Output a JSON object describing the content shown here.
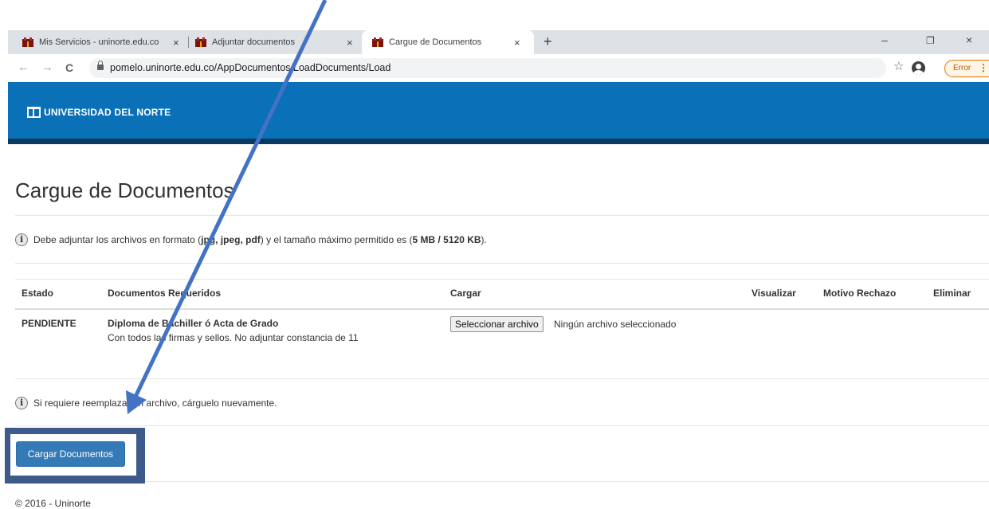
{
  "browser": {
    "tabs": [
      {
        "title": "Mis Servicios - uninorte.edu.co",
        "close": "×"
      },
      {
        "title": "Adjuntar documentos",
        "close": "×"
      },
      {
        "title": "Cargue de Documentos",
        "close": "×"
      }
    ],
    "new_tab": "+",
    "window_controls": {
      "minimize": "–",
      "restore": "❐",
      "close": "×"
    },
    "nav": {
      "back": "←",
      "forward": "→",
      "reload": "C"
    },
    "url": "pomelo.uninorte.edu.co/AppDocumentos/LoadDocuments/Load",
    "bookmark": "☆",
    "error_label": "Error",
    "menu": "⋮"
  },
  "site": {
    "logo_text": "UNIVERSIDAD DEL NORTE",
    "header_color": "#0a70b8"
  },
  "page": {
    "title": "Cargue de Documentos",
    "info_format": {
      "pre": "Debe adjuntar los archivos en formato (",
      "formats": "jpg, jpeg, pdf",
      "mid": ") y el tamaño máximo permitido es (",
      "size": "5 MB / 5120 KB",
      "post": ")."
    },
    "table": {
      "headers": {
        "estado": "Estado",
        "documentos": "Documentos Requeridos",
        "cargar": "Cargar",
        "visualizar": "Visualizar",
        "motivo": "Motivo Rechazo",
        "eliminar": "Eliminar"
      },
      "rows": [
        {
          "estado": "PENDIENTE",
          "doc_title": "Diploma de Bachiller ó Acta de Grado",
          "doc_desc": "Con todos las firmas y sellos. No adjuntar constancia de 11",
          "file_button": "Seleccionar archivo",
          "file_status": "Ningún archivo seleccionado"
        }
      ]
    },
    "info_replace": "Si requiere reemplazar un archivo, cárguelo nuevamente.",
    "submit_label": "Cargar Documentos",
    "footer": "© 2016 - Uninorte"
  }
}
